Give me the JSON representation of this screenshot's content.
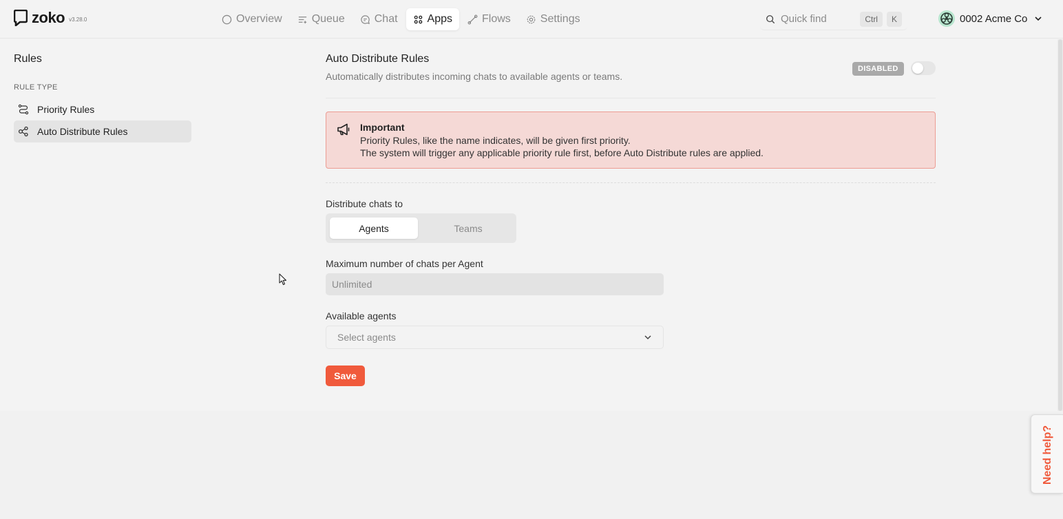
{
  "brand": {
    "name": "zoko",
    "version": "v3.28.0"
  },
  "nav": {
    "items": [
      {
        "label": "Overview",
        "icon": "circle-icon"
      },
      {
        "label": "Queue",
        "icon": "queue-icon"
      },
      {
        "label": "Chat",
        "icon": "chat-icon"
      },
      {
        "label": "Apps",
        "icon": "apps-icon",
        "active": true
      },
      {
        "label": "Flows",
        "icon": "flows-icon"
      },
      {
        "label": "Settings",
        "icon": "gear-icon"
      }
    ]
  },
  "quickfind": {
    "label": "Quick find",
    "key1": "Ctrl",
    "key2": "K"
  },
  "account": {
    "name": "0002 Acme Co"
  },
  "sidebar": {
    "title": "Rules",
    "section": "RULE TYPE",
    "items": [
      {
        "label": "Priority Rules",
        "icon": "route-icon"
      },
      {
        "label": "Auto Distribute Rules",
        "icon": "share-nodes-icon",
        "active": true
      }
    ]
  },
  "main": {
    "title": "Auto Distribute Rules",
    "subtitle": "Automatically distributes incoming chats to available agents or teams.",
    "status_badge": "DISABLED",
    "toggle_on": false,
    "alert": {
      "title": "Important",
      "line1": "Priority Rules, like the name indicates, will be given first priority.",
      "line2": "The system will trigger any applicable priority rule first, before Auto Distribute rules are applied."
    },
    "distribute_label": "Distribute chats to",
    "distribute_options": [
      {
        "label": "Agents",
        "selected": true
      },
      {
        "label": "Teams",
        "selected": false
      }
    ],
    "max_chats_label": "Maximum number of chats per Agent",
    "max_chats_placeholder": "Unlimited",
    "agents_label": "Available agents",
    "agents_placeholder": "Select agents",
    "save_label": "Save"
  },
  "help": {
    "label": "Need help?"
  },
  "colors": {
    "accent": "#f05a3c",
    "alert_bg": "#f5d9d6",
    "alert_border": "#ec9c93",
    "badge_bg": "#a9a9a9"
  }
}
